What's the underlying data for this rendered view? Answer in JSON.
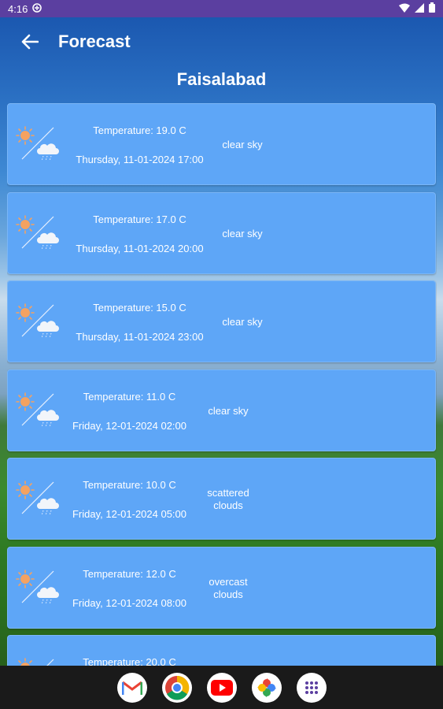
{
  "status": {
    "time": "4:16"
  },
  "appbar": {
    "title": "Forecast"
  },
  "city": "Faisalabad",
  "forecasts": [
    {
      "temperature": "Temperature: 19.0 C",
      "datetime": "Thursday, 11-01-2024 17:00",
      "condition": "clear sky"
    },
    {
      "temperature": "Temperature: 17.0 C",
      "datetime": "Thursday, 11-01-2024 20:00",
      "condition": "clear sky"
    },
    {
      "temperature": "Temperature: 15.0 C",
      "datetime": "Thursday, 11-01-2024 23:00",
      "condition": "clear sky"
    },
    {
      "temperature": "Temperature: 11.0 C",
      "datetime": "Friday, 12-01-2024 02:00",
      "condition": "clear sky"
    },
    {
      "temperature": "Temperature: 10.0 C",
      "datetime": "Friday, 12-01-2024 05:00",
      "condition": "scattered\nclouds"
    },
    {
      "temperature": "Temperature: 12.0 C",
      "datetime": "Friday, 12-01-2024 08:00",
      "condition": "overcast\nclouds"
    },
    {
      "temperature": "Temperature: 20.0 C",
      "datetime": "",
      "condition": ""
    }
  ],
  "dock": [
    "gmail-icon",
    "chrome-icon",
    "youtube-icon",
    "photos-icon",
    "app-drawer-icon"
  ],
  "colors": {
    "card": "#5ea6f7",
    "statusbar": "#5b3fa0",
    "navbar": "#1a1a1a"
  }
}
